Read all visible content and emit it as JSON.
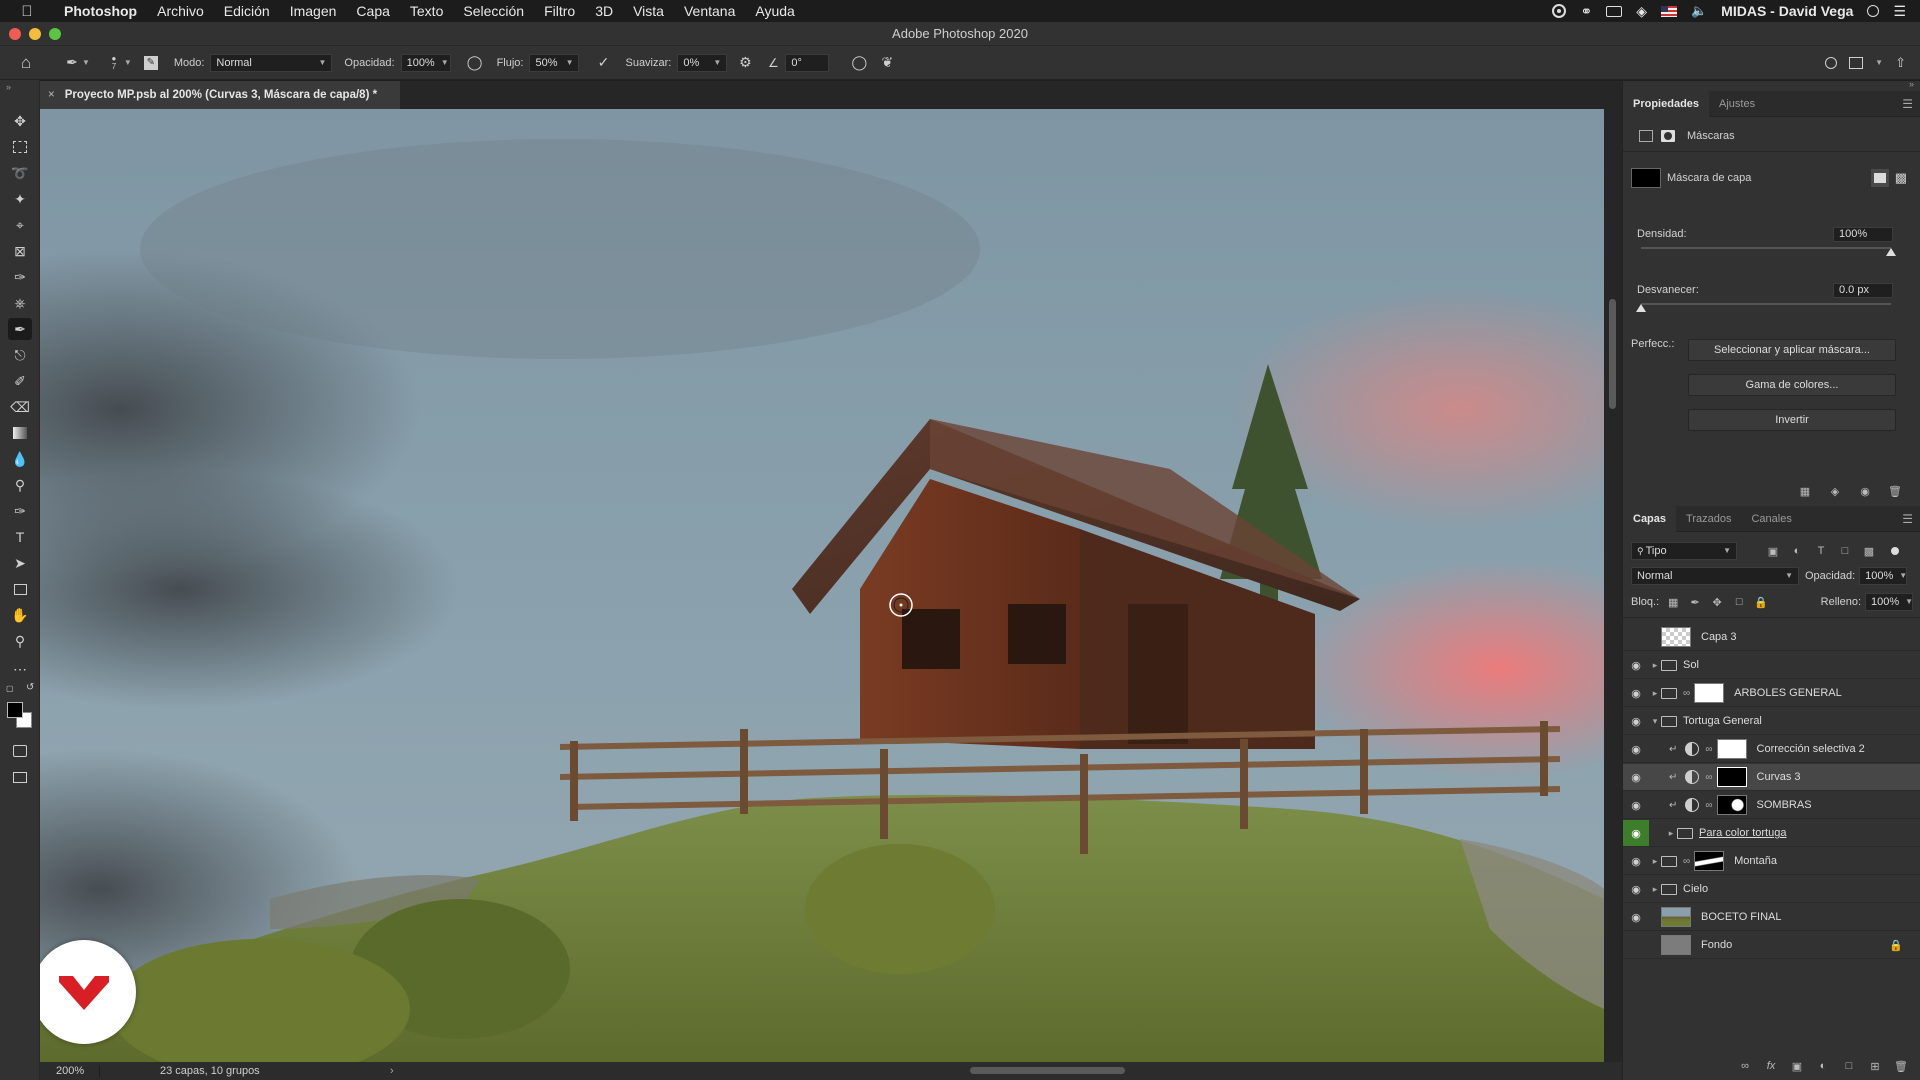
{
  "menubar": {
    "app_name": "Photoshop",
    "items": [
      "Archivo",
      "Edición",
      "Imagen",
      "Capa",
      "Texto",
      "Selección",
      "Filtro",
      "3D",
      "Vista",
      "Ventana",
      "Ayuda"
    ],
    "user": "MIDAS - David Vega"
  },
  "window": {
    "title": "Adobe Photoshop 2020"
  },
  "options": {
    "brush_size": "7",
    "mode_label": "Modo:",
    "mode_value": "Normal",
    "opacity_label": "Opacidad:",
    "opacity_value": "100%",
    "flow_label": "Flujo:",
    "flow_value": "50%",
    "smooth_label": "Suavizar:",
    "smooth_value": "0%",
    "angle_value": "0°"
  },
  "document": {
    "tab_title": "Proyecto MP.psb al 200% (Curvas 3, Máscara de capa/8) *",
    "zoom": "200%",
    "info": "23 capas, 10 grupos"
  },
  "properties": {
    "tabs": [
      "Propiedades",
      "Ajustes"
    ],
    "section": "Máscaras",
    "mask_label": "Máscara de capa",
    "density_label": "Densidad:",
    "density_value": "100%",
    "density_level": 1.0,
    "feather_label": "Desvanecer:",
    "feather_value": "0.0 px",
    "feather_level": 0.0,
    "refine_label": "Perfecc.:",
    "btn_select_mask": "Seleccionar y aplicar máscara...",
    "btn_color_range": "Gama de colores...",
    "btn_invert": "Invertir"
  },
  "layers_panel": {
    "tabs": [
      "Capas",
      "Trazados",
      "Canales"
    ],
    "filter_value": "Tipo",
    "blend_value": "Normal",
    "opacity_label": "Opacidad:",
    "opacity_value": "100%",
    "lock_label": "Bloq.:",
    "fill_label": "Relleno:",
    "fill_value": "100%",
    "layers": [
      {
        "name": "Capa 3",
        "visible": false,
        "type": "pixel"
      },
      {
        "name": "Sol",
        "visible": true,
        "type": "group"
      },
      {
        "name": "ARBOLES GENERAL",
        "visible": true,
        "type": "group-mask"
      },
      {
        "name": "Tortuga General",
        "visible": true,
        "type": "group-open"
      },
      {
        "name": "Corrección selectiva 2",
        "visible": true,
        "type": "adjustment"
      },
      {
        "name": "Curvas 3",
        "visible": true,
        "type": "adjustment",
        "selected": true
      },
      {
        "name": "SOMBRAS",
        "visible": true,
        "type": "adjustment"
      },
      {
        "name": "Para color tortuga",
        "visible": true,
        "type": "group-sub"
      },
      {
        "name": "Montaña",
        "visible": true,
        "type": "group-mask"
      },
      {
        "name": "Cielo",
        "visible": true,
        "type": "group"
      },
      {
        "name": "BOCETO FINAL",
        "visible": true,
        "type": "image"
      },
      {
        "name": "Fondo",
        "visible": false,
        "type": "background"
      }
    ]
  },
  "colors": {
    "accent_green": "#3d7d2c",
    "logo_red": "#d91f26"
  }
}
